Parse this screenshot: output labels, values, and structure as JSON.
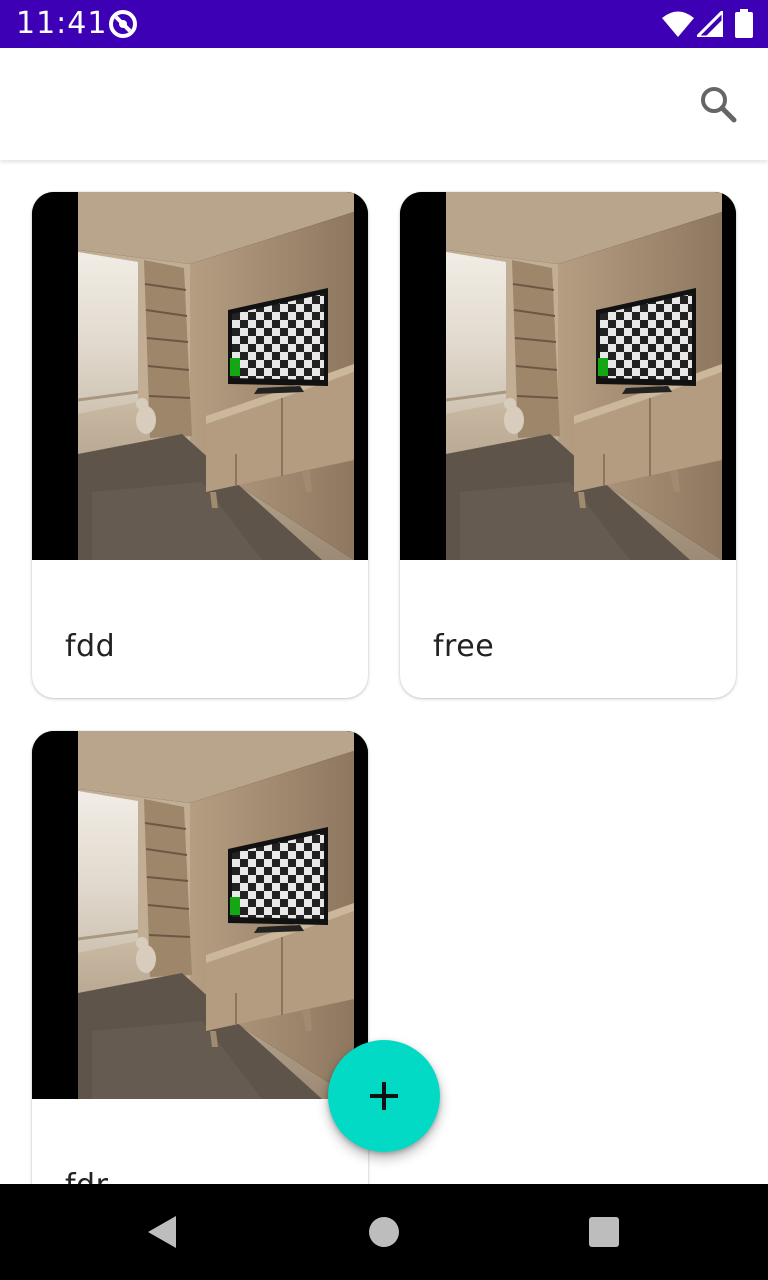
{
  "status_bar": {
    "time": "11:41",
    "background": "#3d00b5",
    "icons": [
      "app-notification-icon",
      "wifi-icon",
      "cell-signal-icon",
      "battery-icon"
    ]
  },
  "app_bar": {
    "actions": [
      "search-icon"
    ]
  },
  "cards": [
    {
      "title": "fdd"
    },
    {
      "title": "free"
    },
    {
      "title": "fdr"
    }
  ],
  "fab": {
    "icon": "plus-icon",
    "color": "#03dac6"
  },
  "nav_bar": {
    "icons": [
      "back-icon",
      "home-icon",
      "recents-icon"
    ]
  }
}
